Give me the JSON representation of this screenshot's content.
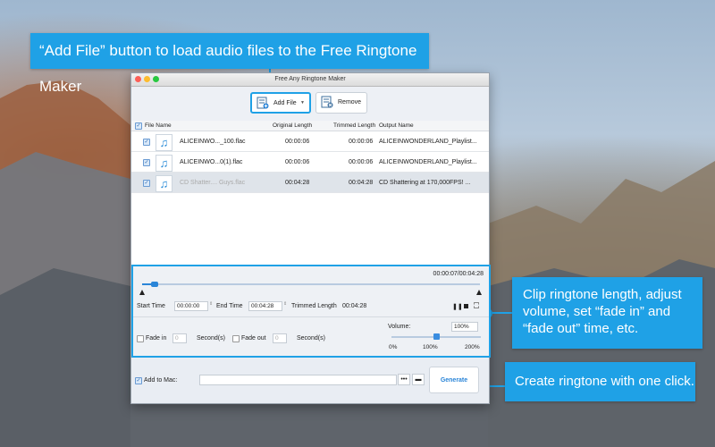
{
  "window": {
    "title": "Free Any Ringtone Maker"
  },
  "toolbar": {
    "add_file_label": "Add File",
    "add_file_arrow": "▼",
    "remove_label": "Remove"
  },
  "list": {
    "headers": {
      "file_name": "File Name",
      "original_length": "Original Length",
      "trimmed_length": "Trimmed Length",
      "output_name": "Output Name"
    },
    "rows": [
      {
        "file_name": "ALICEINWO..._100.flac",
        "original_length": "00:00:06",
        "trimmed_length": "00:00:06",
        "output_name": "ALICEINWONDERLAND_Playlist..."
      },
      {
        "file_name": "ALICEINWO...0(1).flac",
        "original_length": "00:00:06",
        "trimmed_length": "00:00:06",
        "output_name": "ALICEINWONDERLAND_Playlist..."
      },
      {
        "file_name": "CD Shatter.... Guys.flac",
        "original_length": "00:04:28",
        "trimmed_length": "00:04:28",
        "output_name": "CD Shattering at 170,000FPS! ..."
      }
    ]
  },
  "editor": {
    "time_display": "00:00:07/00:04:28",
    "progress_fraction": 0.027,
    "start_time_label": "Start Time",
    "start_time_value": "00:00:00",
    "end_time_label": "End Time",
    "end_time_value": "00:04:28",
    "trimmed_length_label": "Trimmed Length",
    "trimmed_length_value": "00:04:28",
    "fade_in_label": "Fade in",
    "fade_in_value": "0",
    "fade_in_unit": "Second(s)",
    "fade_out_label": "Fade out",
    "fade_out_value": "0",
    "fade_out_unit": "Second(s)",
    "volume_label": "Volume:",
    "volume_value": "100%",
    "volume_min": "0%",
    "volume_mid": "100%",
    "volume_max": "200%",
    "volume_fraction": 0.5
  },
  "bottom": {
    "add_to_mac_label": "Add to Mac:",
    "browse_label": "•••",
    "generate_label": "Generate"
  },
  "callouts": {
    "top": "“Add File” button to load audio files to the Free Ringtone Maker",
    "right": "Clip ringtone length, adjust volume, set “fade in” and “fade out” time, etc.",
    "bottom": "Create ringtone with one click."
  },
  "colors": {
    "accent": "#1fa1e6",
    "generate_text": "#2a85d8"
  }
}
